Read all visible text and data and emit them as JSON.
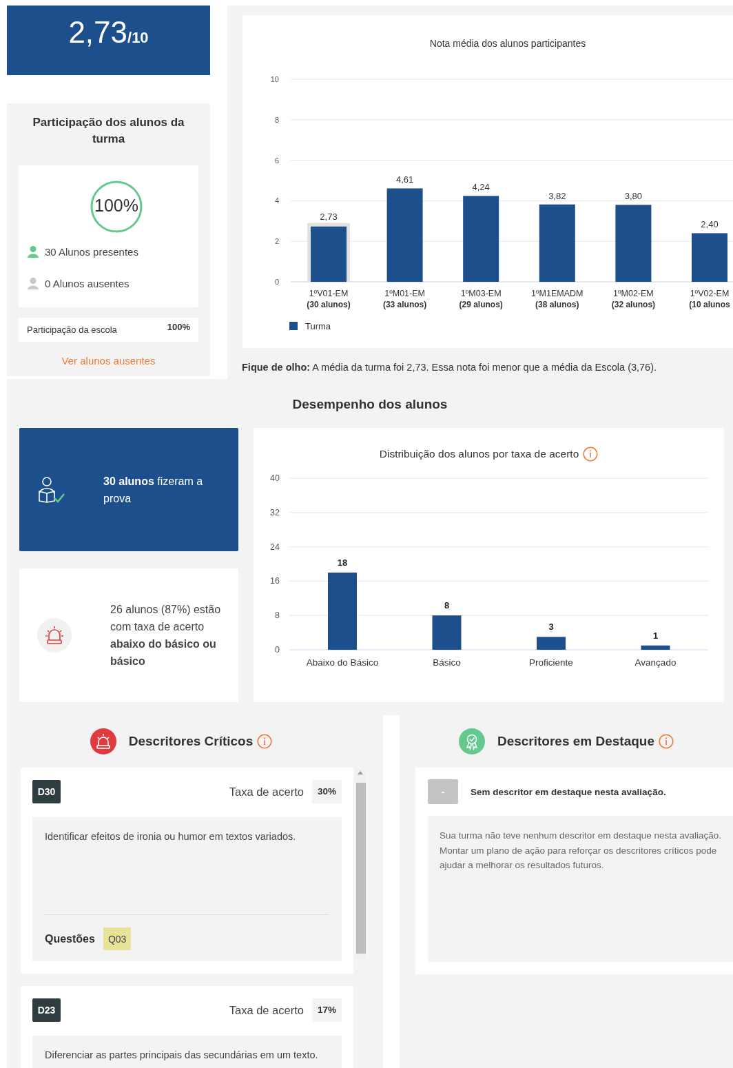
{
  "score": {
    "value": "2,73",
    "scale": "/10"
  },
  "participation": {
    "title": "Participação dos alunos da turma",
    "rate": "100%",
    "level": 1,
    "counts": [
      {
        "kind": "present",
        "text": "30 Alunos presentes"
      },
      {
        "kind": "absent",
        "text": "0 Alunos ausentes"
      }
    ],
    "school": {
      "label": "Participação da escola",
      "value": "100%"
    },
    "link": "Ver alunos ausentes"
  },
  "class_average_chart": {
    "chart_data": {
      "type": "bar",
      "title": "Nota média dos alunos participantes",
      "categories": [
        "1ºV01-EM",
        "1ºM01-EM",
        "1ºM03-EM",
        "1ºM1EMADM",
        "1ºM02-EM",
        "1ºV02-EM"
      ],
      "series": [
        {
          "name": "Turma",
          "color": "#1d4f8c",
          "values": [
            2.73,
            4.61,
            4.24,
            3.82,
            3.8,
            2.4
          ]
        }
      ],
      "ylim": [
        0,
        10
      ],
      "yticks": [
        0,
        2,
        4,
        6,
        8,
        10
      ],
      "grid": true,
      "value_labels": [
        "2,73",
        "4,61",
        "4,24",
        "3,82",
        "3,80",
        "2,40"
      ]
    },
    "group_sizes": [
      "(30 alunos)",
      "(33 alunos)",
      "(29 alunos)",
      "(38 alunos)",
      "(32 alunos)",
      "(10 alunos"
    ],
    "bars": [
      {
        "selected": true
      },
      {
        "selected": false
      },
      {
        "selected": false
      },
      {
        "selected": false
      },
      {
        "selected": false
      },
      {
        "selected": false
      }
    ]
  },
  "note": "**Fique de olho:** A média da turma foi 2,73. Essa nota foi menor que a média da Escola (3,76).",
  "performance": {
    "title": "Desempenho dos alunos",
    "summary_cards": [
      {
        "kind": "tested",
        "text": "**30 alunos** fizeram a prova"
      },
      {
        "kind": "alert",
        "text": "26 alunos (87%) estão com taxa de acerto **abaixo do básico ou básico**"
      }
    ],
    "distribution_chart": {
      "chart_data": {
        "type": "bar",
        "title": "Distribuição dos alunos por taxa de acerto",
        "categories": [
          "Abaixo do Básico",
          "Básico",
          "Proficiente",
          "Avançado"
        ],
        "values": [
          18,
          8,
          3,
          1
        ],
        "ylim": [
          0,
          40
        ],
        "yticks": [
          0,
          8,
          16,
          24,
          32,
          40
        ],
        "grid": true,
        "data_labels": true
      }
    }
  },
  "critical_descriptors": {
    "title": "Descritores Críticos",
    "items": [
      {
        "code": "D30",
        "rate_label": "Taxa de acerto",
        "rate": "30%",
        "description": "Identificar efeitos de ironia ou humor em textos variados.",
        "questions_label": "Questões",
        "questions": [
          "Q03"
        ]
      },
      {
        "code": "D23",
        "rate_label": "Taxa de acerto",
        "rate": "17%",
        "description": "Diferenciar as partes principais das secundárias em um texto."
      }
    ]
  },
  "highlighted_descriptors": {
    "title": "Descritores em Destaque",
    "badge": "-",
    "message": "Sem descritor em destaque nesta avaliação.",
    "description": "Sua turma não teve nenhum descritor em destaque nesta avaliação. Montar um plano de ação para reforçar os descritores críticos pode ajudar a melhorar os resultados futuros."
  }
}
